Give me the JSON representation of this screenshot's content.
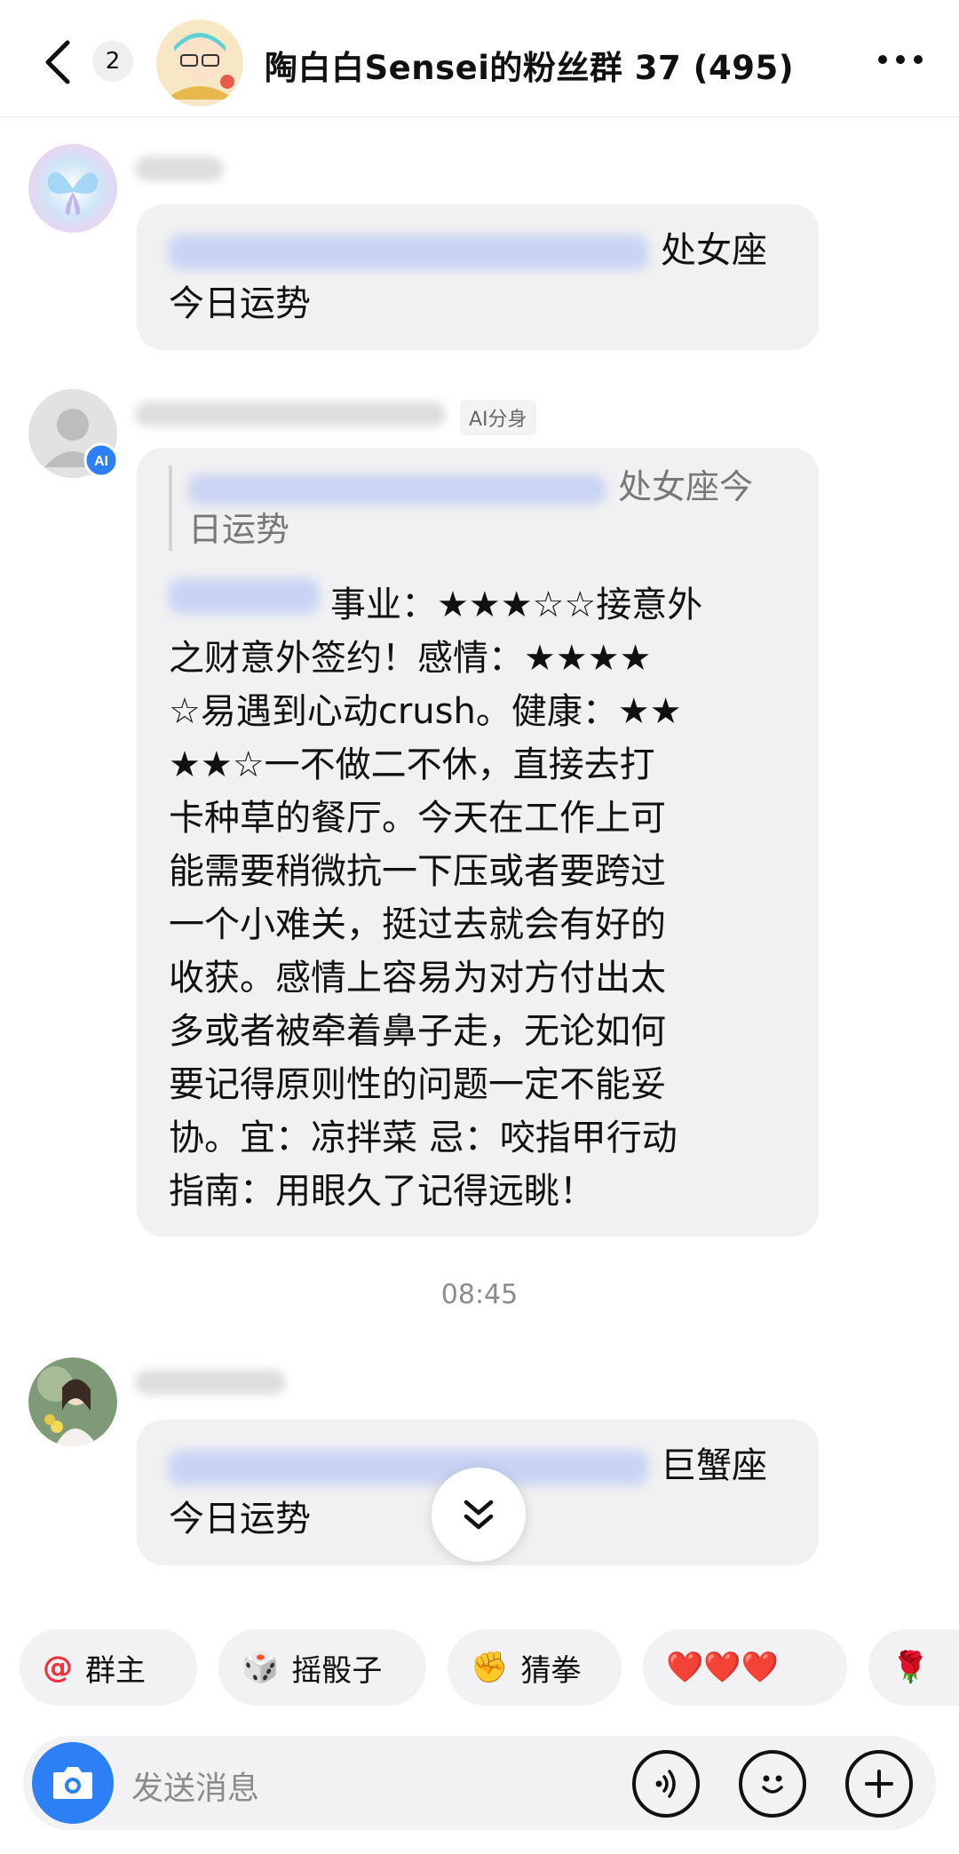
{
  "header": {
    "unread_count": "2",
    "group_title": "陶白白Sensei的粉丝群 37 (495)"
  },
  "messages": [
    {
      "text_suffix": "处女座",
      "text_line2": "今日运势"
    },
    {
      "tag": "AI分身",
      "quote_suffix": "处女座今",
      "quote_line2": "日运势",
      "lines": [
        "事业：★★★☆☆接意外",
        "之财意外签约！感情：★★★★",
        "☆易遇到心动crush。健康：★★",
        "★★☆一不做二不休，直接去打",
        "卡种草的餐厅。今天在工作上可",
        "能需要稍微抗一下压或者要跨过",
        "一个小难关，挺过去就会有好的",
        "收获。感情上容易为对方付出太",
        "多或者被牵着鼻子走，无论如何",
        "要记得原则性的问题一定不能妥",
        "协。宜：凉拌菜 忌：咬指甲行动",
        "指南：用眼久了记得远眺！"
      ]
    },
    {
      "timestamp": "08:45"
    },
    {
      "text_suffix": "巨蟹座",
      "text_line2": "今日运势"
    }
  ],
  "chips": [
    {
      "icon": "@",
      "label": "群主"
    },
    {
      "icon": "🎲",
      "label": "摇骰子"
    },
    {
      "icon": "✊",
      "label": "猜拳"
    },
    {
      "icon": "",
      "label": "❤️❤️❤️"
    },
    {
      "icon": "🌹",
      "label": ""
    }
  ],
  "input": {
    "placeholder": "发送消息"
  },
  "colors": {
    "accent_blue": "#2d7ff6",
    "bubble_bg": "#f1f1f3",
    "heart_red": "#f0323f"
  }
}
